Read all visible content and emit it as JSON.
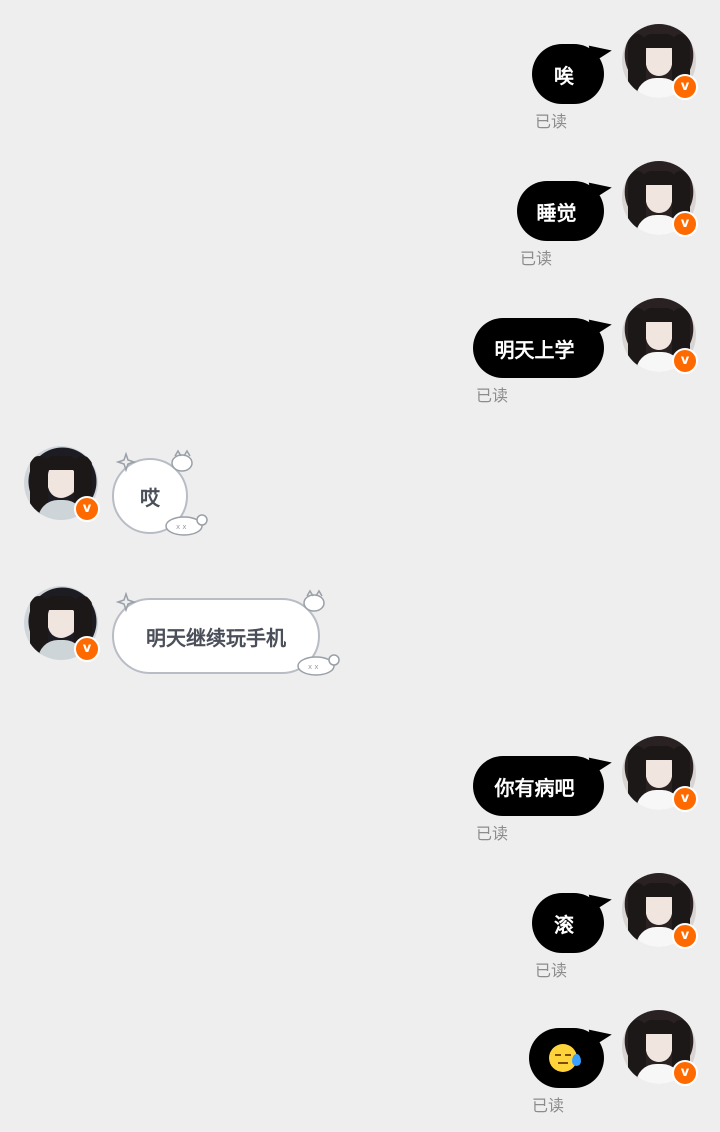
{
  "read_label": "已读",
  "verified_badge": "v",
  "colors": {
    "accent": "#ff6a00",
    "sent_bubble": "#000000",
    "background": "#eeeeee"
  },
  "messages": [
    {
      "dir": "out",
      "text": "唉",
      "status": "已读"
    },
    {
      "dir": "out",
      "text": "睡觉",
      "status": "已读"
    },
    {
      "dir": "out",
      "text": "明天上学",
      "status": "已读"
    },
    {
      "dir": "in",
      "text": "哎"
    },
    {
      "dir": "in",
      "text": "明天继续玩手机"
    },
    {
      "dir": "out",
      "text": "你有病吧",
      "status": "已读"
    },
    {
      "dir": "out",
      "text": "滚",
      "status": "已读"
    },
    {
      "dir": "out",
      "emoji": "sweat-emoji",
      "status": "已读"
    }
  ]
}
